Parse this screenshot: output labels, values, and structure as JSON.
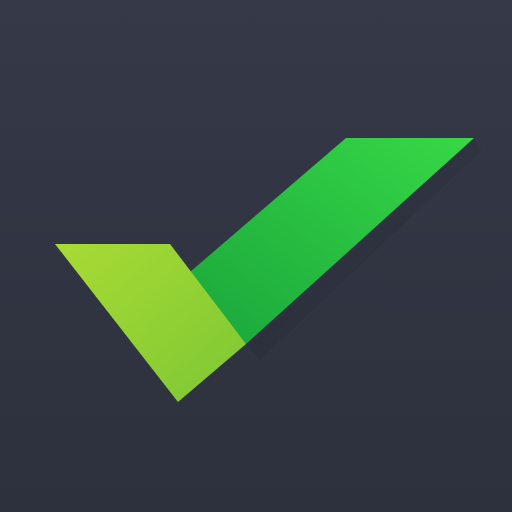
{
  "app_icon": {
    "icon": "checkmark-icon",
    "colors": {
      "background": "#31353f",
      "short_stroke": "#9fd337",
      "long_stroke_light": "#34d14a",
      "long_stroke_dark": "#1fae3f"
    }
  }
}
